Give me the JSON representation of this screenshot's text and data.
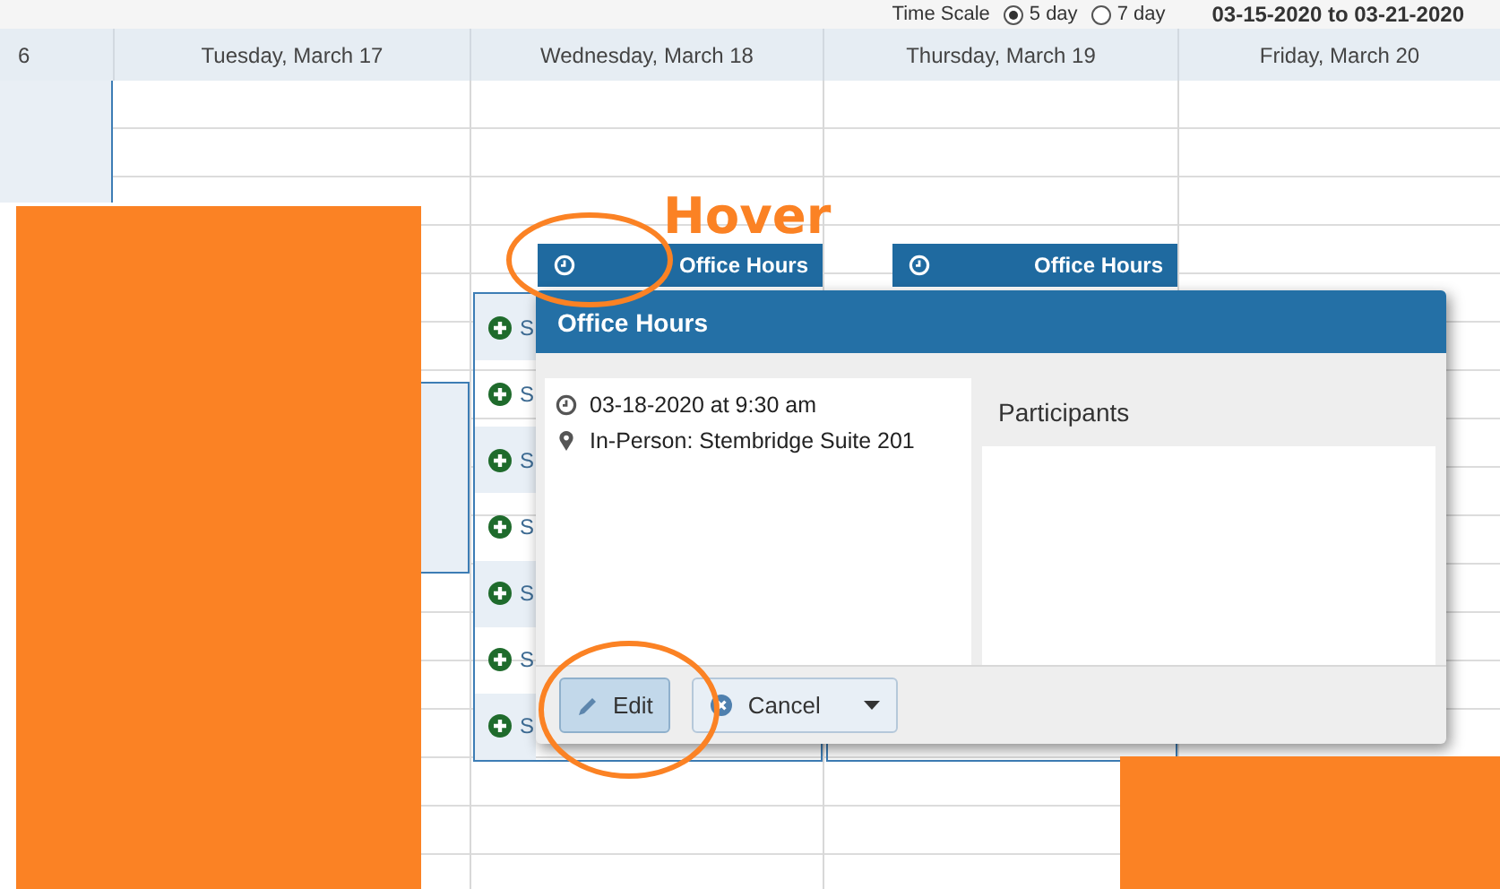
{
  "toolbar": {
    "time_scale_label": "Time Scale",
    "scale_options": [
      {
        "label": "5 day",
        "selected": true
      },
      {
        "label": "7 day",
        "selected": false
      }
    ],
    "date_range": "03-15-2020 to 03-21-2020"
  },
  "day_columns": [
    "6",
    "Tuesday, March 17",
    "Wednesday, March 18",
    "Thursday, March 19",
    "Friday, March 20"
  ],
  "events": [
    {
      "title": "Office Hours"
    },
    {
      "title": "Office Hours"
    }
  ],
  "slot_list": [
    {
      "label": "S"
    },
    {
      "label": "S"
    },
    {
      "label": "S"
    },
    {
      "label": "S"
    },
    {
      "label": "S"
    },
    {
      "label": "S"
    },
    {
      "label": "S"
    }
  ],
  "popup": {
    "title": "Office Hours",
    "datetime": "03-18-2020 at 9:30 am",
    "location": "In-Person: Stembridge Suite 201",
    "participants_label": "Participants",
    "buttons": [
      {
        "label": "Edit",
        "kind": "edit",
        "selected": true
      },
      {
        "label": "Cancel",
        "kind": "cancel",
        "selected": false
      }
    ]
  },
  "annotation": {
    "label": "Hover"
  }
}
